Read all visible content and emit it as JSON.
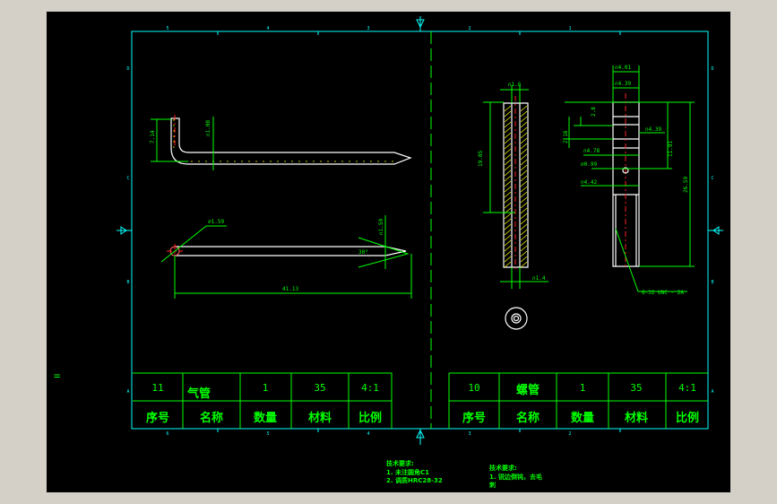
{
  "colors": {
    "background": "#000000",
    "frame": "#00ffff",
    "lines": "#00ff00",
    "part": "#ffffff",
    "centerline": "#ff2020",
    "hatch": "#ffff00"
  },
  "side_mark": "=",
  "border_ticks": {
    "top": [
      "5",
      "4",
      "3",
      "2",
      "1"
    ],
    "bottom": [
      "6",
      "5",
      "4",
      "3",
      "2"
    ],
    "left": [
      "D",
      "C",
      "B",
      "A"
    ]
  },
  "left_table": {
    "values": [
      "11",
      "气管",
      "1",
      "35",
      "4:1"
    ],
    "headers": [
      "序号",
      "名称",
      "数量",
      "材料",
      "比例"
    ]
  },
  "right_table": {
    "values": [
      "10",
      "螺管",
      "1",
      "35",
      "4:1"
    ],
    "headers": [
      "序号",
      "名称",
      "数量",
      "材料",
      "比例"
    ]
  },
  "notes_left": {
    "title": "技术要求:",
    "lines": [
      "1. 未注圆角C1",
      "2. 调质HRC28-32"
    ]
  },
  "notes_right": {
    "title": "技术要求:",
    "lines": [
      "1. 锐边倒钝，去毛",
      "刺"
    ]
  },
  "dims": {
    "tube_height": "7.14",
    "tube_dia": "∩1.08",
    "tube_hole": "⌀1.59",
    "tube_tip": "∩1.59",
    "tube_angle": "30°",
    "tube_length": "41.13",
    "nut_top": "∩1.6",
    "nut_len": "19.05",
    "nut_bottom": "∩1.4",
    "pin_d1": "∩4.01",
    "pin_d2": "∩4.39",
    "pin_s1": "2.8",
    "pin_s2": "2.16",
    "pin_d3": "∩4.39",
    "pin_d4": "∩4.78",
    "pin_hole": "⌀0.99",
    "pin_d5": "∩4.42",
    "pin_l1": "11.91",
    "pin_l2": "26.59",
    "pin_thread": "6-32 UNC - 2A"
  }
}
